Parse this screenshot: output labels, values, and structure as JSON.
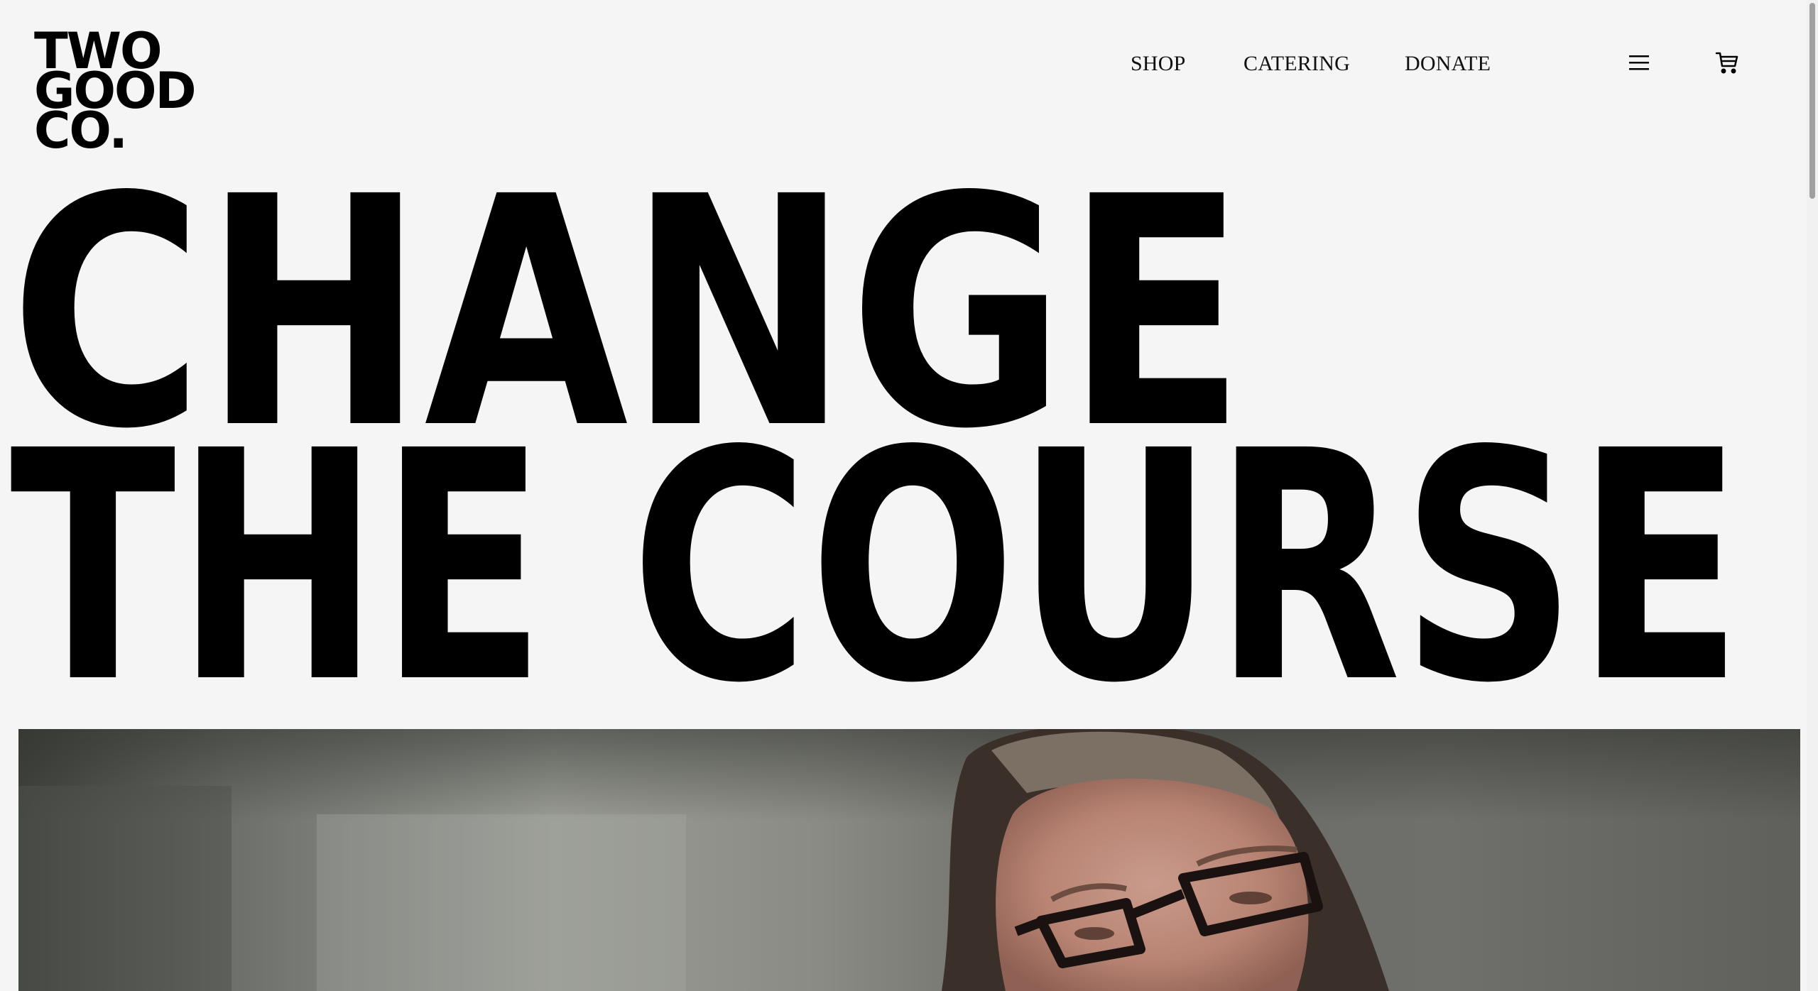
{
  "brand": {
    "logo_line1": "TWO",
    "logo_line2": "GOOD",
    "logo_line3": "CO."
  },
  "nav": {
    "shop": "SHOP",
    "catering": "CATERING",
    "donate": "DONATE"
  },
  "icons": {
    "menu": "hamburger-menu-icon",
    "cart": "shopping-cart-icon"
  },
  "headline": {
    "line1": "CHANGE",
    "line2": "THE COURSE"
  },
  "hero": {
    "media": "video-portrait"
  },
  "colors": {
    "background": "#f5f5f5",
    "text": "#000000"
  }
}
